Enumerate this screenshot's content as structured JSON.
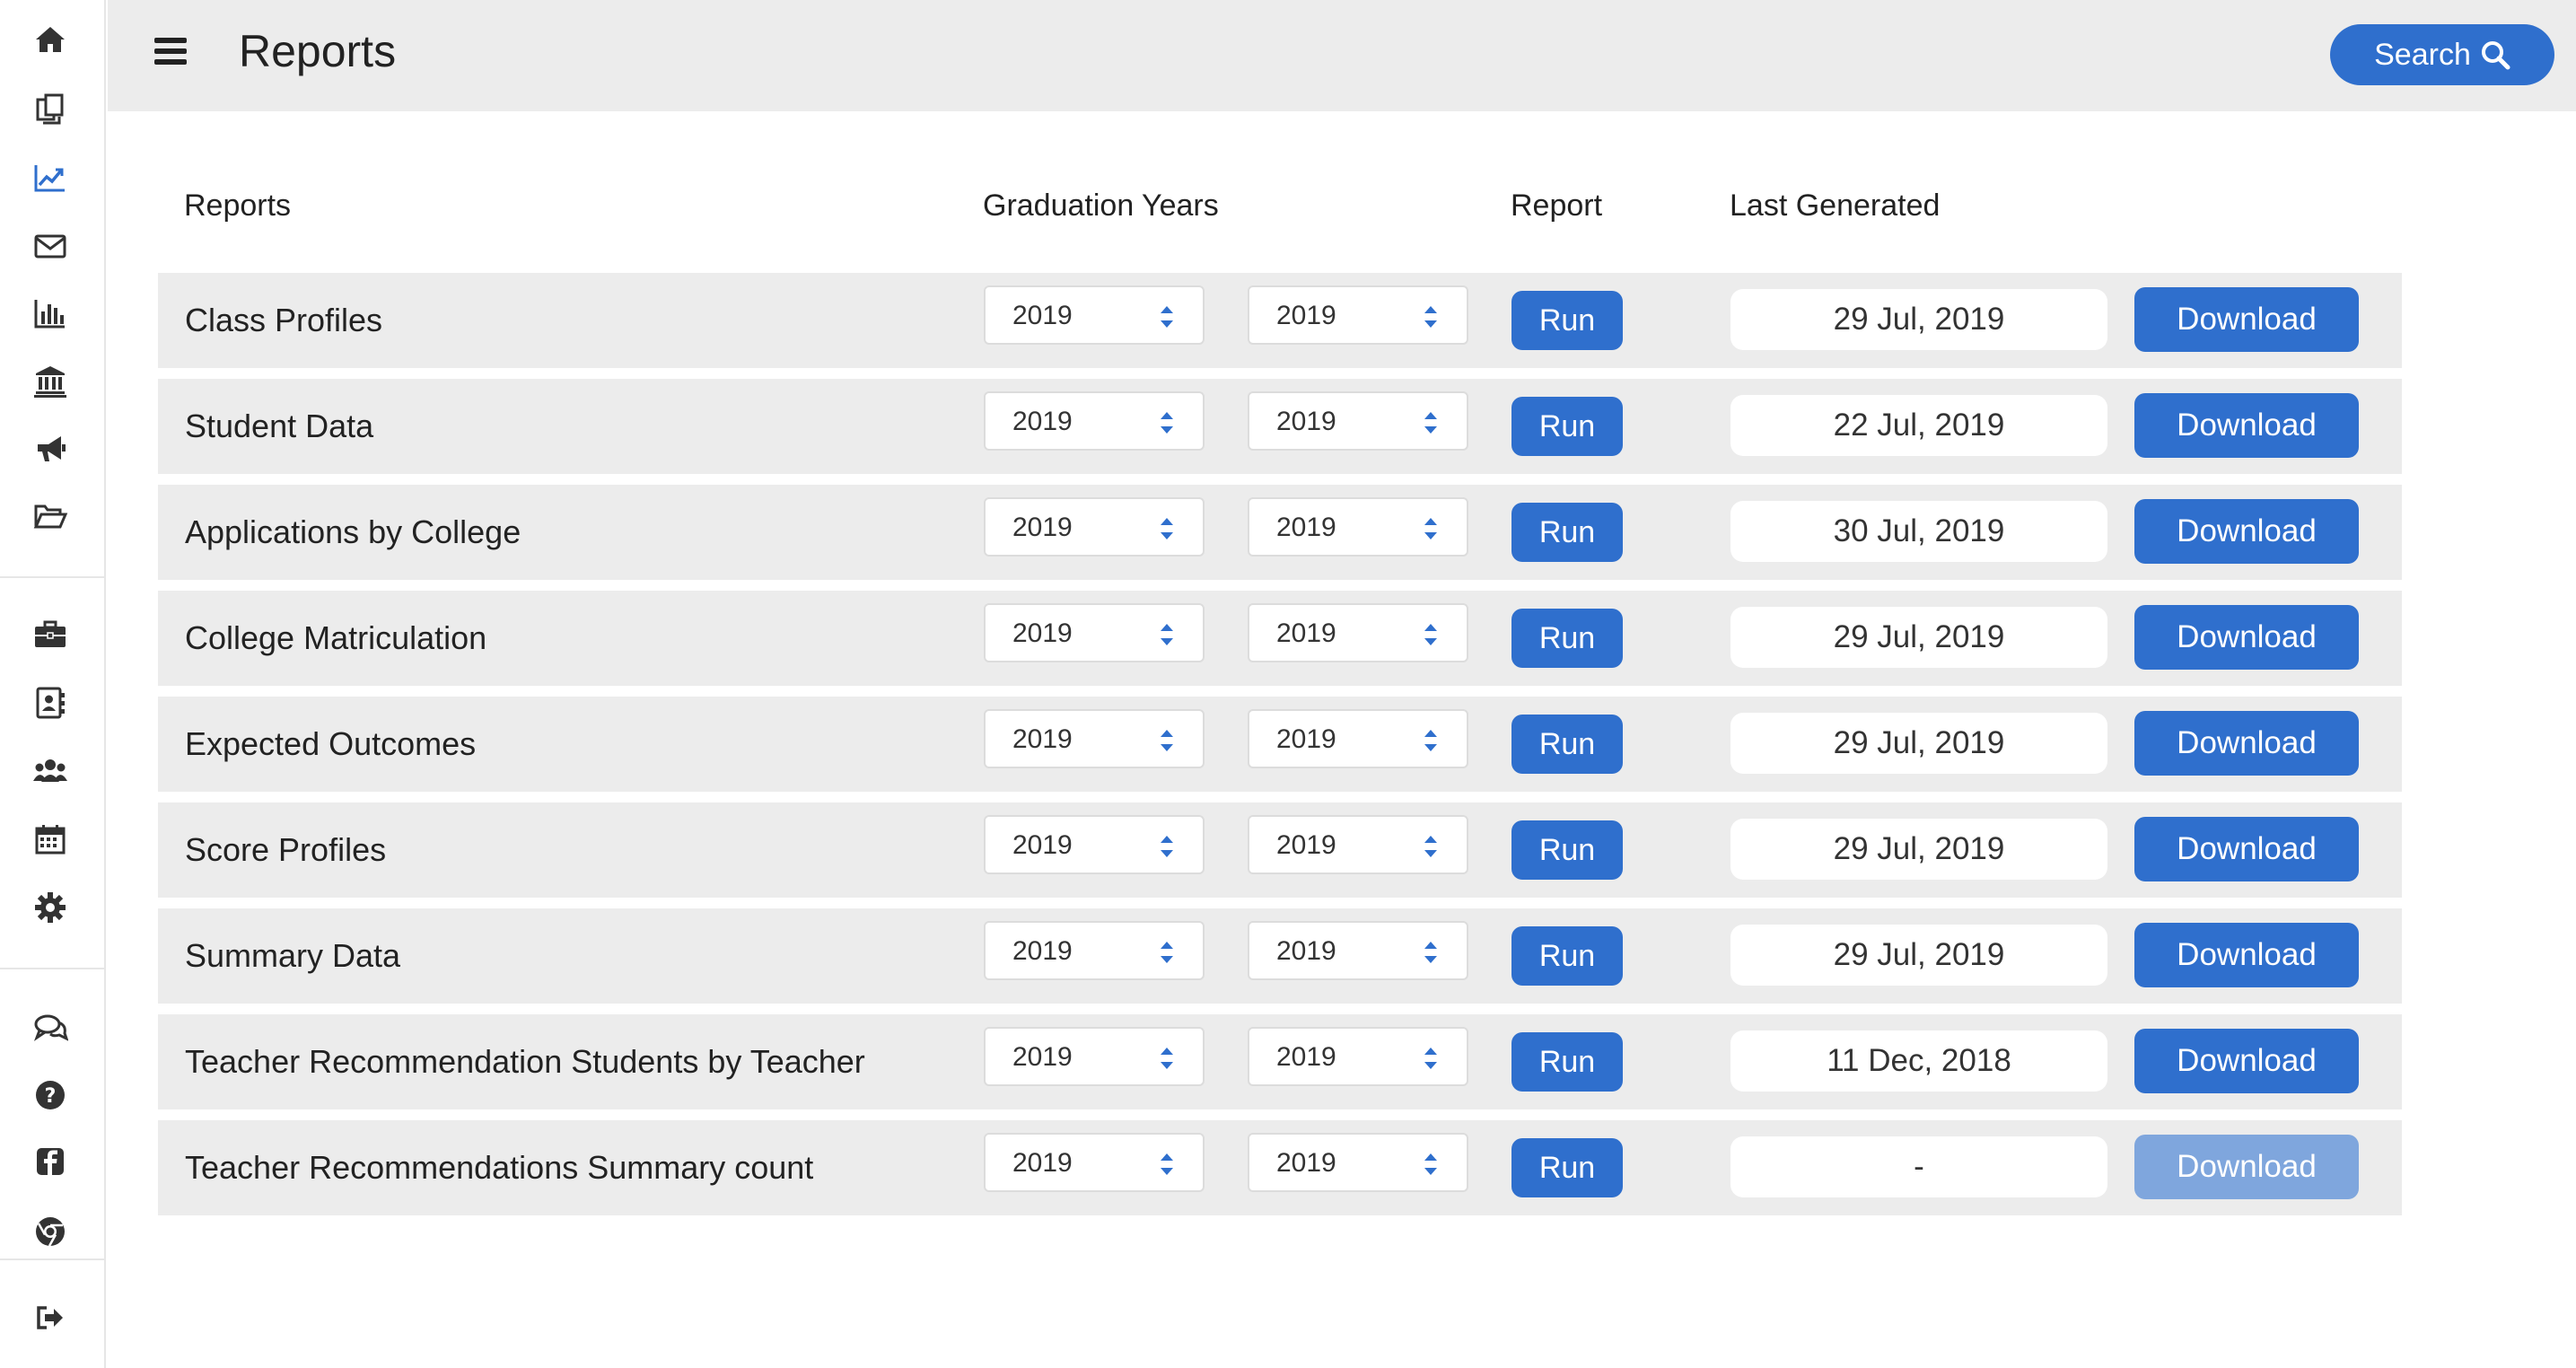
{
  "header": {
    "title": "Reports",
    "search_label": "Search"
  },
  "columns": {
    "reports": "Reports",
    "graduation_years": "Graduation Years",
    "report": "Report",
    "last_generated": "Last Generated"
  },
  "run_label": "Run",
  "download_label": "Download",
  "accent_color": "#2f6fcd",
  "disabled_color": "#7fa6dd",
  "sidebar": {
    "icons": [
      "home-icon",
      "documents-icon",
      "chart-line-icon",
      "envelope-icon",
      "bar-chart-icon",
      "institution-icon",
      "bullhorn-icon",
      "folder-open-icon",
      "briefcase-icon",
      "address-book-icon",
      "users-icon",
      "calendar-icon",
      "gear-icon",
      "comments-icon",
      "question-circle-icon",
      "facebook-icon",
      "chrome-icon",
      "sign-out-icon"
    ],
    "active": "chart-line-icon"
  },
  "rows": [
    {
      "name": "Class Profiles",
      "year_from": "2019",
      "year_to": "2019",
      "last_generated": "29 Jul, 2019",
      "download_enabled": true
    },
    {
      "name": "Student Data",
      "year_from": "2019",
      "year_to": "2019",
      "last_generated": "22 Jul, 2019",
      "download_enabled": true
    },
    {
      "name": "Applications by College",
      "year_from": "2019",
      "year_to": "2019",
      "last_generated": "30 Jul, 2019",
      "download_enabled": true
    },
    {
      "name": "College Matriculation",
      "year_from": "2019",
      "year_to": "2019",
      "last_generated": "29 Jul, 2019",
      "download_enabled": true
    },
    {
      "name": "Expected Outcomes",
      "year_from": "2019",
      "year_to": "2019",
      "last_generated": "29 Jul, 2019",
      "download_enabled": true
    },
    {
      "name": "Score Profiles",
      "year_from": "2019",
      "year_to": "2019",
      "last_generated": "29 Jul, 2019",
      "download_enabled": true
    },
    {
      "name": "Summary Data",
      "year_from": "2019",
      "year_to": "2019",
      "last_generated": "29 Jul, 2019",
      "download_enabled": true
    },
    {
      "name": "Teacher Recommendation Students by Teacher",
      "year_from": "2019",
      "year_to": "2019",
      "last_generated": "11 Dec, 2018",
      "download_enabled": true
    },
    {
      "name": "Teacher Recommendations Summary count",
      "year_from": "2019",
      "year_to": "2019",
      "last_generated": "-",
      "download_enabled": false
    }
  ]
}
